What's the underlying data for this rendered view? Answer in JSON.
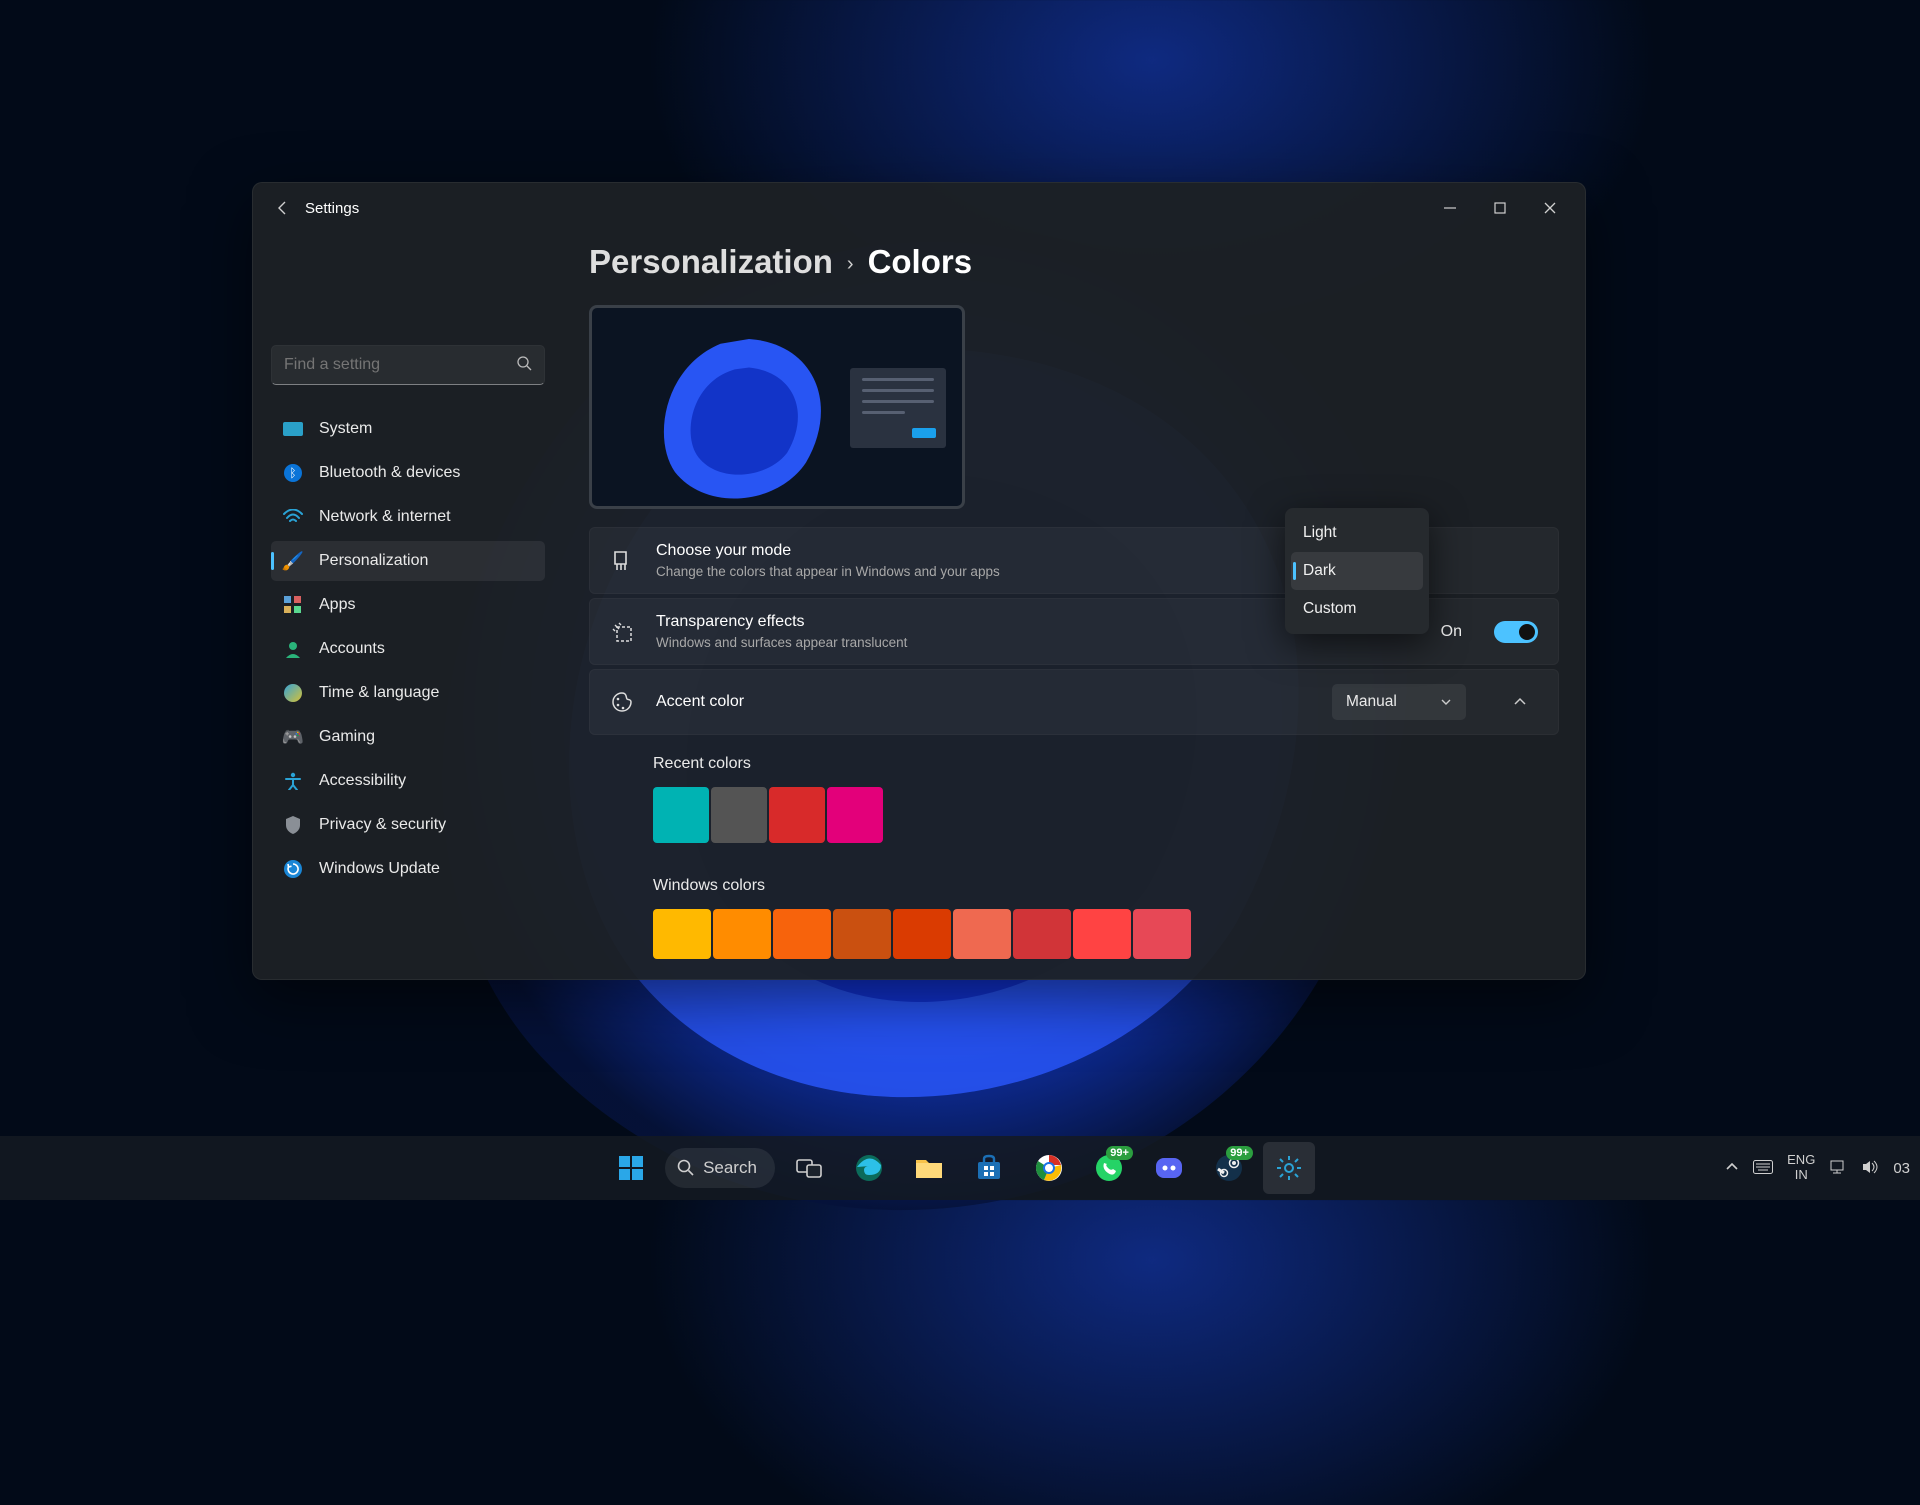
{
  "window": {
    "app_title": "Settings"
  },
  "search": {
    "placeholder": "Find a setting"
  },
  "sidebar": {
    "items": [
      {
        "label": "System"
      },
      {
        "label": "Bluetooth & devices"
      },
      {
        "label": "Network & internet"
      },
      {
        "label": "Personalization"
      },
      {
        "label": "Apps"
      },
      {
        "label": "Accounts"
      },
      {
        "label": "Time & language"
      },
      {
        "label": "Gaming"
      },
      {
        "label": "Accessibility"
      },
      {
        "label": "Privacy & security"
      },
      {
        "label": "Windows Update"
      }
    ]
  },
  "breadcrumb": {
    "parent": "Personalization",
    "current": "Colors"
  },
  "panels": {
    "mode": {
      "title": "Choose your mode",
      "subtitle": "Change the colors that appear in Windows and your apps"
    },
    "transparency": {
      "title": "Transparency effects",
      "subtitle": "Windows and surfaces appear translucent",
      "toggle_label": "On"
    },
    "accent": {
      "title": "Accent color",
      "dropdown_value": "Manual"
    }
  },
  "mode_menu": {
    "options": [
      {
        "label": "Light"
      },
      {
        "label": "Dark"
      },
      {
        "label": "Custom"
      }
    ]
  },
  "recent_colors": {
    "title": "Recent colors",
    "swatches": [
      "#00b3b3",
      "#545454",
      "#d82a2a",
      "#e3007a"
    ]
  },
  "windows_colors": {
    "title": "Windows colors",
    "swatches": [
      "#ffb900",
      "#ff8c00",
      "#f7630c",
      "#ca5010",
      "#da3b01",
      "#ef6950",
      "#d13438",
      "#ff4343",
      "#e74856"
    ]
  },
  "taskbar": {
    "search_label": "Search",
    "badges": {
      "whatsapp": "99+",
      "steam": "99+"
    }
  },
  "systray": {
    "lang1": "ENG",
    "lang2": "IN",
    "time": "03"
  }
}
